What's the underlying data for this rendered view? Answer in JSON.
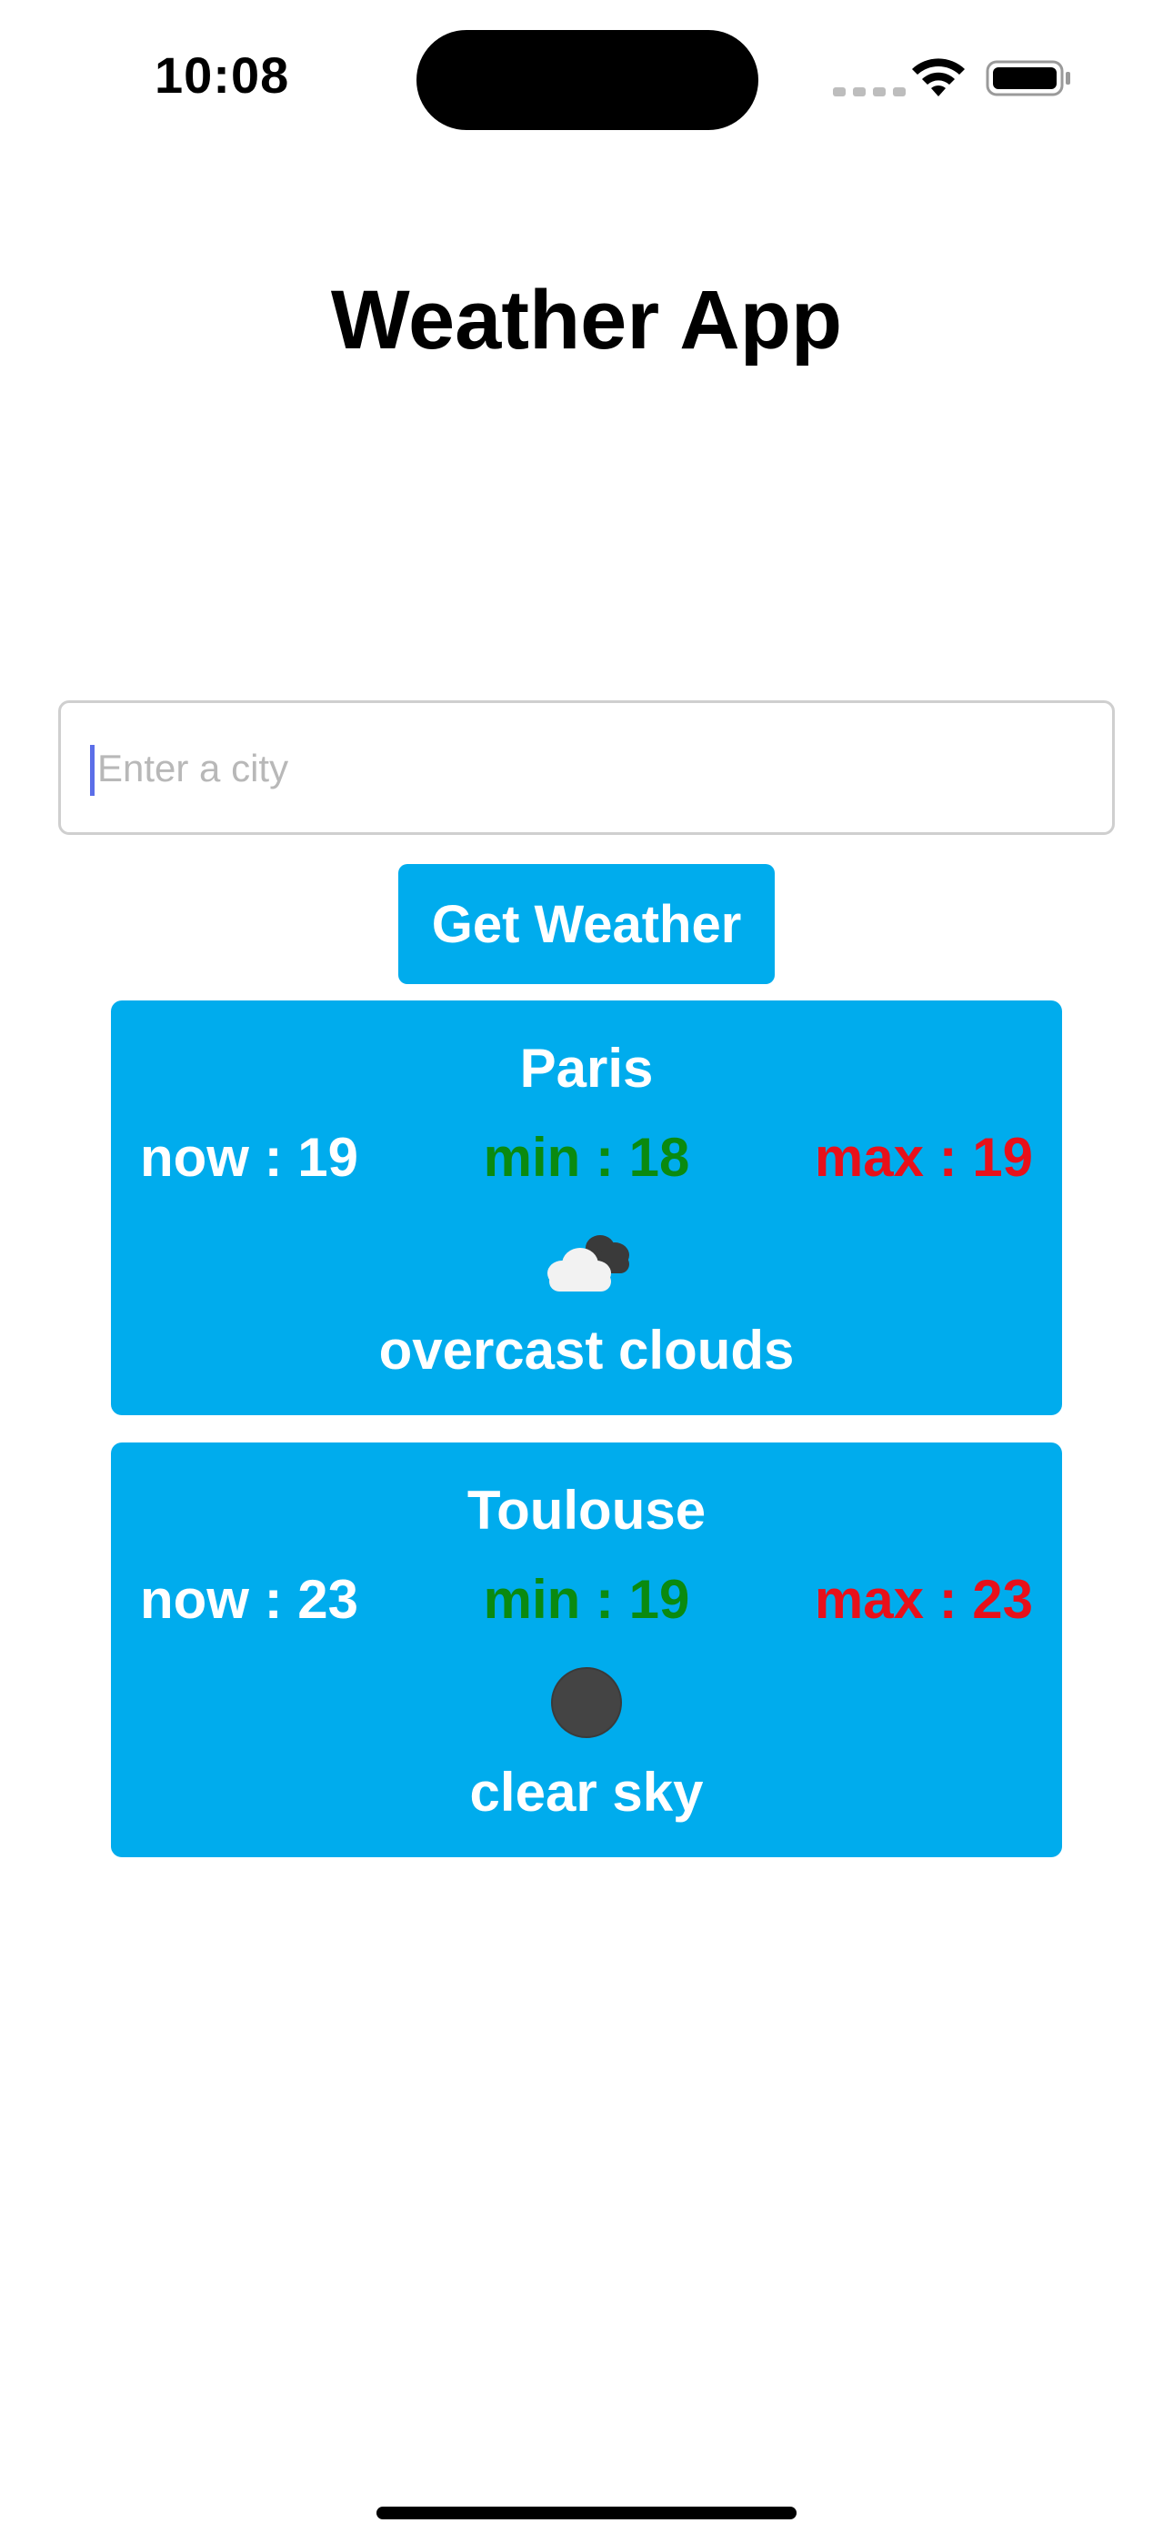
{
  "status_bar": {
    "time": "10:08"
  },
  "header": {
    "title": "Weather App"
  },
  "search": {
    "placeholder": "Enter a city",
    "value": ""
  },
  "actions": {
    "get_weather_label": "Get Weather"
  },
  "cards": [
    {
      "city": "Paris",
      "now": "now : 19",
      "min": "min : 18",
      "max": "max : 19",
      "icon": "overcast-clouds-icon",
      "description": "overcast clouds"
    },
    {
      "city": "Toulouse",
      "now": "now : 23",
      "min": "min : 19",
      "max": "max : 23",
      "icon": "clear-sky-night-icon",
      "description": "clear sky"
    }
  ],
  "colors": {
    "card_background": "#00aced",
    "min_text": "#0a8a10",
    "max_text": "#e8101a",
    "button_background": "#00aced"
  }
}
